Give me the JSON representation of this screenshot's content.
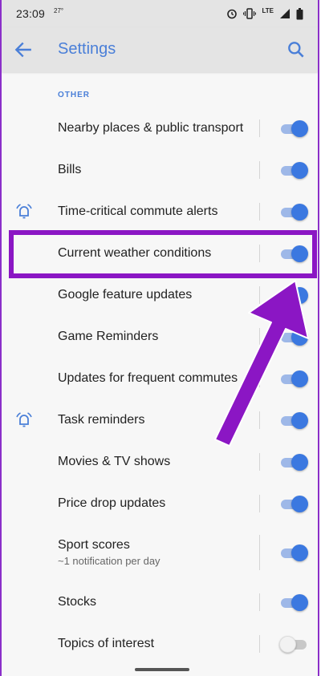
{
  "status_bar": {
    "time": "23:09",
    "temperature": "27°",
    "network": "LTE",
    "icons": [
      "alarm-clock-icon",
      "vibrate-icon",
      "signal-icon",
      "battery-icon"
    ]
  },
  "app_bar": {
    "title": "Settings",
    "back_icon": "arrow-back-icon",
    "search_icon": "search-icon"
  },
  "section": {
    "header": "OTHER"
  },
  "settings": [
    {
      "label": "Nearby places & public transport",
      "enabled": true
    },
    {
      "label": "Bills",
      "enabled": true
    },
    {
      "label": "Time-critical commute alerts",
      "enabled": true,
      "icon": "alarm-bell-icon"
    },
    {
      "label": "Current weather conditions",
      "enabled": true,
      "highlighted": true
    },
    {
      "label": "Google feature updates",
      "enabled": true
    },
    {
      "label": "Game Reminders",
      "enabled": true
    },
    {
      "label": "Updates for frequent commutes",
      "enabled": true
    },
    {
      "label": "Task reminders",
      "enabled": true,
      "icon": "alarm-bell-icon"
    },
    {
      "label": "Movies & TV shows",
      "enabled": true
    },
    {
      "label": "Price drop updates",
      "enabled": true
    },
    {
      "label": "Sport scores",
      "subtitle": "~1 notification per day",
      "enabled": true
    },
    {
      "label": "Stocks",
      "enabled": true
    },
    {
      "label": "Topics of interest",
      "enabled": false
    }
  ],
  "colors": {
    "accent": "#4a7fd8",
    "toggle_on": "#3b78e0",
    "annotation": "#8b16c4"
  }
}
